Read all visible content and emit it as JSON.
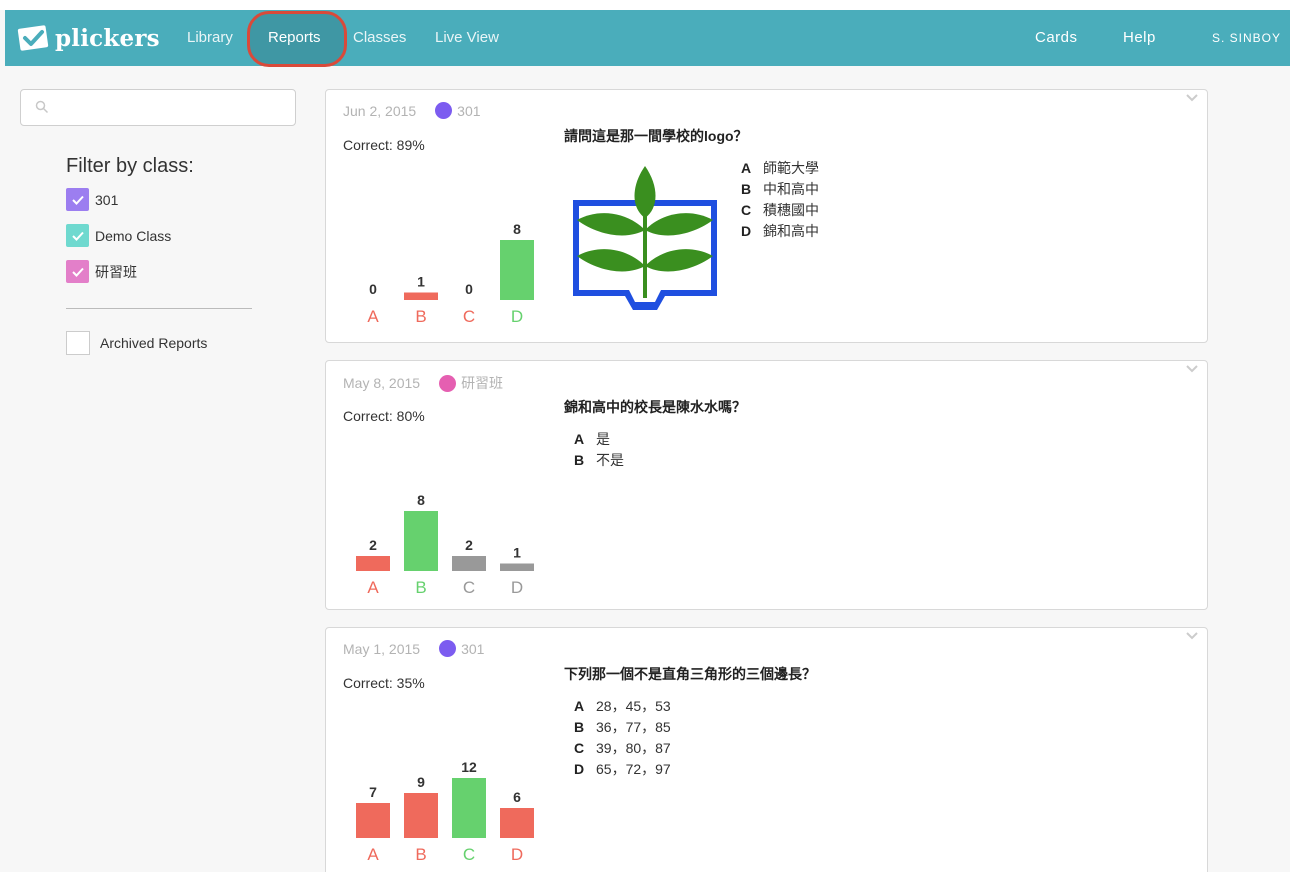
{
  "brand": {
    "name": "plickers"
  },
  "nav": {
    "items": [
      {
        "label": "Library",
        "active": false
      },
      {
        "label": "Reports",
        "active": true
      },
      {
        "label": "Classes",
        "active": false
      },
      {
        "label": "Live View",
        "active": false
      }
    ],
    "right": {
      "cards": "Cards",
      "help": "Help",
      "user": "S. SINBOY"
    }
  },
  "colors": {
    "topbar": "#4aadbb",
    "correct": "#66d16e",
    "incorrect": "#ef6a5c",
    "neutral": "#999999",
    "class_301": "#7c5cf0",
    "class_demo": "#6fd9cf",
    "class_study": "#e55fb1",
    "highlight": "#d94a3a"
  },
  "sidebar": {
    "search": {
      "placeholder": "",
      "icon": "search-icon"
    },
    "filter_title": "Filter by class:",
    "classes": [
      {
        "label": "301",
        "checked": true,
        "color": "#9c7ef0"
      },
      {
        "label": "Demo Class",
        "checked": true,
        "color": "#6fd9cf"
      },
      {
        "label": "研習班",
        "checked": true,
        "color": "#e37fc9"
      }
    ],
    "archived": {
      "label": "Archived Reports",
      "checked": false
    }
  },
  "reports": [
    {
      "date": "Jun 2, 2015",
      "class_name": "301",
      "class_color": "#7c5cf0",
      "correct": "Correct: 89%",
      "question": "請問這是那一間學校的logo？",
      "answers": [
        {
          "letter": "A",
          "text": "師範大學"
        },
        {
          "letter": "B",
          "text": "中和高中"
        },
        {
          "letter": "C",
          "text": "積穗國中"
        },
        {
          "letter": "D",
          "text": "錦和高中"
        }
      ],
      "has_image": true,
      "chart_data": {
        "type": "bar",
        "categories": [
          "A",
          "B",
          "C",
          "D"
        ],
        "values": [
          0,
          1,
          0,
          8
        ],
        "bar_colors": [
          "#ef6a5c",
          "#ef6a5c",
          "#ef6a5c",
          "#66d16e"
        ],
        "label_colors": [
          "#ef6a5c",
          "#ef6a5c",
          "#ef6a5c",
          "#66d16e"
        ],
        "max": 8
      }
    },
    {
      "date": "May 8, 2015",
      "class_name": "研習班",
      "class_color": "#e55fb1",
      "correct": "Correct: 80%",
      "question": "錦和高中的校長是陳水水嗎？",
      "answers": [
        {
          "letter": "A",
          "text": "是"
        },
        {
          "letter": "B",
          "text": "不是"
        }
      ],
      "has_image": false,
      "chart_data": {
        "type": "bar",
        "categories": [
          "A",
          "B",
          "C",
          "D"
        ],
        "values": [
          2,
          8,
          2,
          1
        ],
        "bar_colors": [
          "#ef6a5c",
          "#66d16e",
          "#999999",
          "#999999"
        ],
        "label_colors": [
          "#ef6a5c",
          "#66d16e",
          "#999999",
          "#999999"
        ],
        "max": 8
      }
    },
    {
      "date": "May 1, 2015",
      "class_name": "301",
      "class_color": "#7c5cf0",
      "correct": "Correct: 35%",
      "question": "下列那一個不是直角三角形的三個邊長？",
      "answers": [
        {
          "letter": "A",
          "text": "28，45，53"
        },
        {
          "letter": "B",
          "text": "36，77，85"
        },
        {
          "letter": "C",
          "text": "39，80，87"
        },
        {
          "letter": "D",
          "text": "65，72，97"
        }
      ],
      "has_image": false,
      "chart_data": {
        "type": "bar",
        "categories": [
          "A",
          "B",
          "C",
          "D"
        ],
        "values": [
          7,
          9,
          12,
          6
        ],
        "bar_colors": [
          "#ef6a5c",
          "#ef6a5c",
          "#66d16e",
          "#ef6a5c"
        ],
        "label_colors": [
          "#ef6a5c",
          "#ef6a5c",
          "#66d16e",
          "#ef6a5c"
        ],
        "max": 12
      }
    }
  ]
}
